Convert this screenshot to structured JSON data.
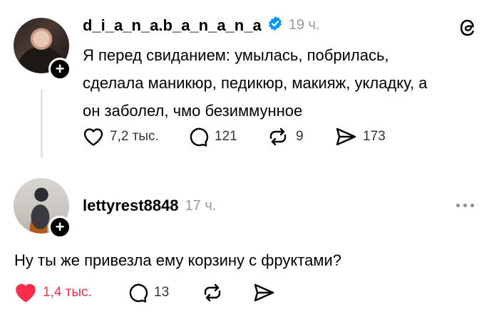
{
  "post": {
    "username": "d_i_a_n_a.b_a_n_a_n_a",
    "time": "19 ч.",
    "text_line1": "Я перед свиданием:  умылась, побрилась,",
    "text_line2": "сделала маникюр, педикюр, макияж, укладку, а",
    "text_line3": "он заболел, чмо безиммунное",
    "likes": "7,2 тыс.",
    "comments": "121",
    "reposts": "9",
    "shares": "173"
  },
  "reply": {
    "username": "lettyrest8848",
    "time": "17 ч.",
    "text": "Ну ты же привезла ему корзину с фруктами?",
    "likes": "1,4 тыс.",
    "comments": "13"
  },
  "colors": {
    "accent_like": "#ff2b4a",
    "verified_badge": "#0095f6"
  }
}
